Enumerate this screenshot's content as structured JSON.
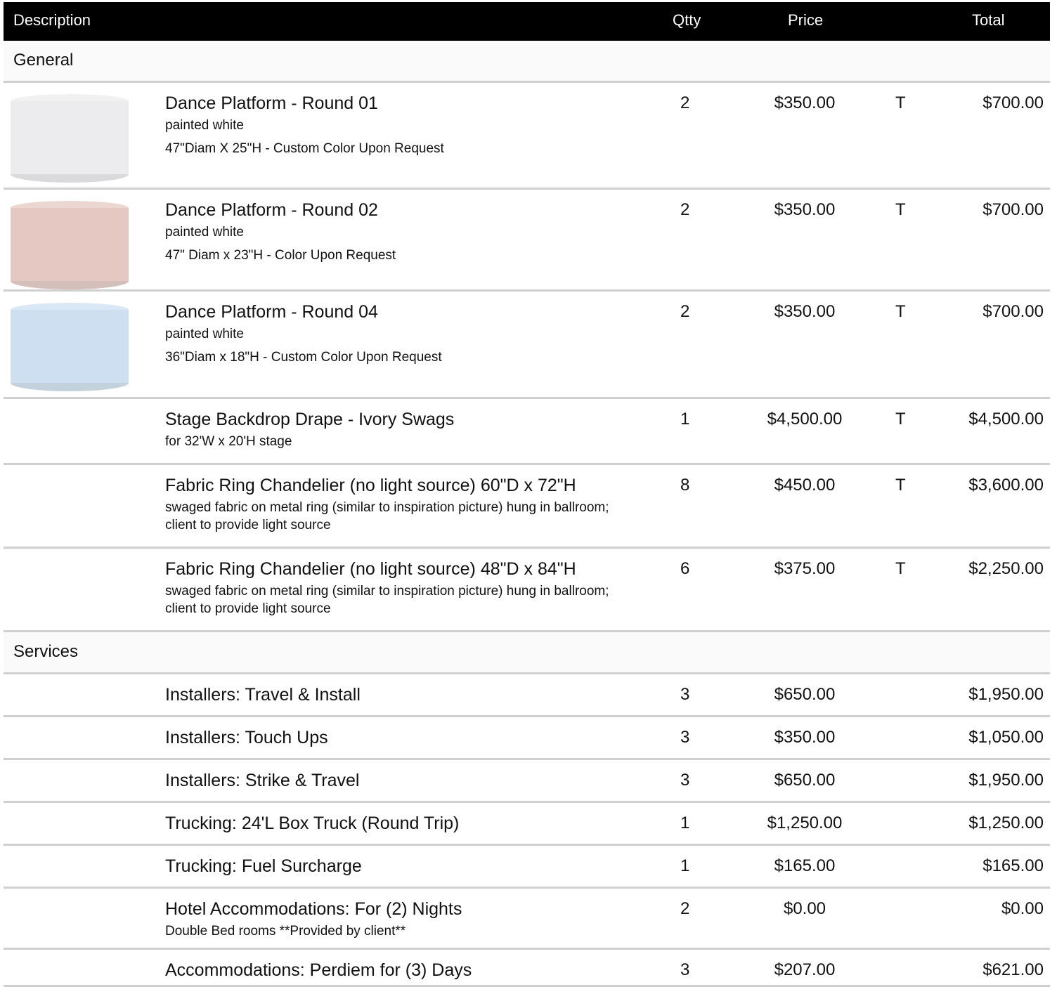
{
  "header": {
    "description": "Description",
    "qty": "Qtty",
    "price": "Price",
    "total": "Total"
  },
  "sections": [
    {
      "label": "General",
      "rows": [
        {
          "image": "white-round-platform",
          "image_color": "#ececee",
          "title": "Dance Platform - Round 01",
          "lines": [
            "painted white",
            "47\"Diam X 25\"H - Custom Color Upon Request"
          ],
          "qty": "2",
          "price": "$350.00",
          "tax": "T",
          "total": "$700.00"
        },
        {
          "image": "pink-round-platform",
          "image_color": "#e5c8c2",
          "title": "Dance Platform - Round 02",
          "lines": [
            "painted white",
            "47\" Diam x 23\"H - Color Upon Request"
          ],
          "qty": "2",
          "price": "$350.00",
          "tax": "T",
          "total": "$700.00"
        },
        {
          "image": "blue-round-platform",
          "image_color": "#cddff0",
          "title": "Dance Platform - Round 04",
          "lines": [
            "painted white",
            "36\"Diam x 18\"H - Custom Color Upon Request"
          ],
          "qty": "2",
          "price": "$350.00",
          "tax": "T",
          "total": "$700.00"
        },
        {
          "title": "Stage Backdrop Drape - Ivory Swags",
          "lines": [
            "for 32'W x 20'H stage"
          ],
          "qty": "1",
          "price": "$4,500.00",
          "tax": "T",
          "total": "$4,500.00"
        },
        {
          "title": "Fabric Ring Chandelier (no light source) 60\"D x 72\"H",
          "lines": [
            "swaged fabric on metal ring (similar to inspiration picture) hung in ballroom; client to provide light source"
          ],
          "qty": "8",
          "price": "$450.00",
          "tax": "T",
          "total": "$3,600.00"
        },
        {
          "title": "Fabric Ring Chandelier (no light source) 48\"D x 84\"H",
          "lines": [
            "swaged fabric on metal ring (similar to inspiration picture) hung in ballroom; client to provide light source"
          ],
          "qty": "6",
          "price": "$375.00",
          "tax": "T",
          "total": "$2,250.00"
        }
      ]
    },
    {
      "label": "Services",
      "rows": [
        {
          "title": "Installers: Travel & Install",
          "lines": [],
          "qty": "3",
          "price": "$650.00",
          "tax": "",
          "total": "$1,950.00"
        },
        {
          "title": "Installers: Touch Ups",
          "lines": [],
          "qty": "3",
          "price": "$350.00",
          "tax": "",
          "total": "$1,050.00"
        },
        {
          "title": "Installers: Strike & Travel",
          "lines": [],
          "qty": "3",
          "price": "$650.00",
          "tax": "",
          "total": "$1,950.00"
        },
        {
          "title": "Trucking: 24'L Box Truck (Round Trip)",
          "lines": [],
          "qty": "1",
          "price": "$1,250.00",
          "tax": "",
          "total": "$1,250.00"
        },
        {
          "title": "Trucking: Fuel Surcharge",
          "lines": [],
          "qty": "1",
          "price": "$165.00",
          "tax": "",
          "total": "$165.00"
        },
        {
          "title": "Hotel Accommodations: For (2) Nights",
          "lines": [
            "Double Bed rooms **Provided by client**"
          ],
          "qty": "2",
          "price": "$0.00",
          "tax": "",
          "total": "$0.00"
        },
        {
          "title": "Accommodations: Perdiem for (3) Days",
          "lines": [],
          "qty": "3",
          "price": "$207.00",
          "tax": "",
          "total": "$621.00"
        }
      ]
    }
  ]
}
